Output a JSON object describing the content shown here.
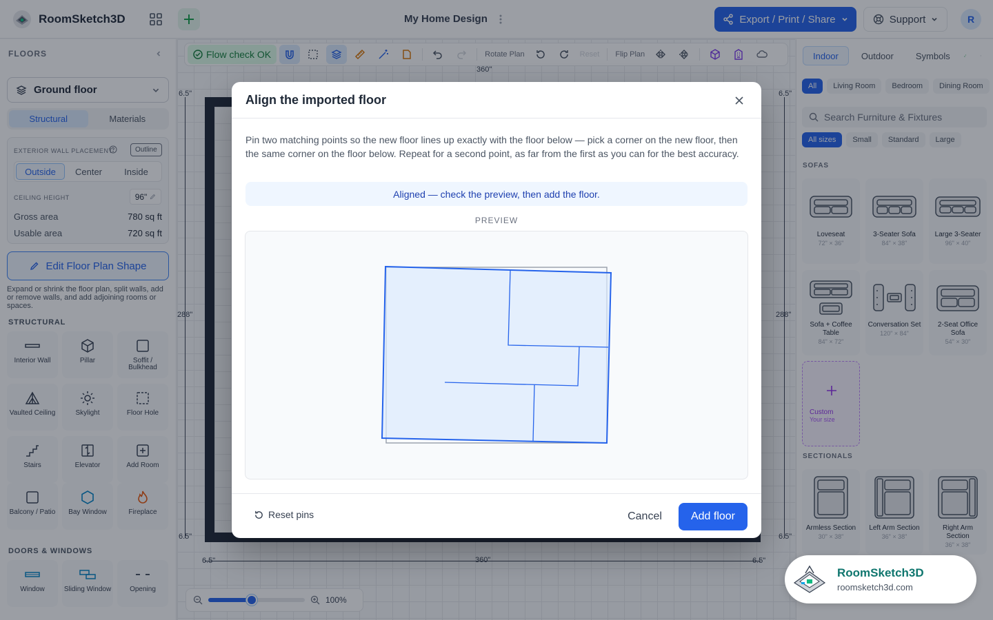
{
  "app": {
    "name": "RoomSketch3D",
    "document_title": "My Home Design",
    "user_initial": "R"
  },
  "header": {
    "export_label": "Export / Print / Share",
    "support_label": "Support"
  },
  "sidebar": {
    "heading": "FLOORS",
    "floor_name": "Ground floor",
    "tabs": [
      "Structural",
      "Materials"
    ],
    "wall_placement_label": "EXTERIOR WALL PLACEMENT",
    "outline_label": "Outline",
    "placement_options": [
      "Outside",
      "Center",
      "Inside"
    ],
    "ceiling_label": "CEILING HEIGHT",
    "ceiling_value": "96\"",
    "gross_label": "Gross area",
    "gross_value": "780 sq ft",
    "usable_label": "Usable area",
    "usable_value": "720 sq ft",
    "edit_shape_label": "Edit Floor Plan Shape",
    "edit_help": "Expand or shrink the floor plan, split walls, add or remove walls, and add adjoining rooms or spaces.",
    "structural_title": "STRUCTURAL",
    "structural_tools": [
      "Interior Wall",
      "Pillar",
      "Soffit / Bulkhead",
      "Vaulted Ceiling",
      "Skylight",
      "Floor Hole",
      "Stairs",
      "Elevator",
      "Add Room",
      "Balcony / Patio",
      "Bay Window",
      "Fireplace"
    ],
    "doors_title": "DOORS & WINDOWS",
    "door_tools": [
      "Window",
      "Sliding Window",
      "Opening"
    ]
  },
  "toolbar": {
    "flow_check": "Flow check OK",
    "rotate_label": "Rotate Plan",
    "reset_label": "Reset",
    "flip_label": "Flip Plan"
  },
  "canvas": {
    "dims": {
      "top_width": "360\"",
      "bottom_width": "360\"",
      "left_height": "288\"",
      "right_height": "288\"",
      "wall": "6.5\""
    },
    "zoom_value": "100%",
    "zoom_fraction": 0.45
  },
  "right_panel": {
    "tabs": [
      "Indoor",
      "Outdoor",
      "Symbols"
    ],
    "room_chips": [
      "All",
      "Living Room",
      "Bedroom",
      "Dining Room"
    ],
    "search_placeholder": "Search Furniture & Fixtures",
    "size_chips": [
      "All sizes",
      "Small",
      "Standard",
      "Large"
    ],
    "sofas_title": "SOFAS",
    "sofas": [
      {
        "name": "Loveseat",
        "size": "72\" × 36\""
      },
      {
        "name": "3-Seater Sofa",
        "size": "84\" × 38\""
      },
      {
        "name": "Large 3-Seater",
        "size": "96\" × 40\""
      },
      {
        "name": "Sofa + Coffee Table",
        "size": "84\" × 72\""
      },
      {
        "name": "Conversation Set",
        "size": "120\" × 84\""
      },
      {
        "name": "2-Seat Office Sofa",
        "size": "54\" × 30\""
      }
    ],
    "custom_label": "Custom",
    "custom_sub": "Your size",
    "sectionals_title": "SECTIONALS",
    "sectionals": [
      {
        "name": "Armless Section",
        "size": "30\" × 38\""
      },
      {
        "name": "Left Arm Section",
        "size": "36\" × 38\""
      },
      {
        "name": "Right Arm Section",
        "size": "36\" × 38\""
      }
    ]
  },
  "watermark": {
    "name": "RoomSketch3D",
    "url": "roomsketch3d.com"
  },
  "modal": {
    "title": "Align the imported floor",
    "description": "Pin two matching points so the new floor lines up exactly with the floor below — pick a corner on the new floor, then the same corner on the floor below. Repeat for a second point, as far from the first as you can for the best accuracy.",
    "status": "Aligned — check the preview, then add the floor.",
    "preview_label": "PREVIEW",
    "reset_pins": "Reset pins",
    "cancel": "Cancel",
    "add_floor": "Add floor"
  },
  "colors": {
    "accent": "#2563eb",
    "success": "#15803d",
    "wall": "#1f2937"
  }
}
